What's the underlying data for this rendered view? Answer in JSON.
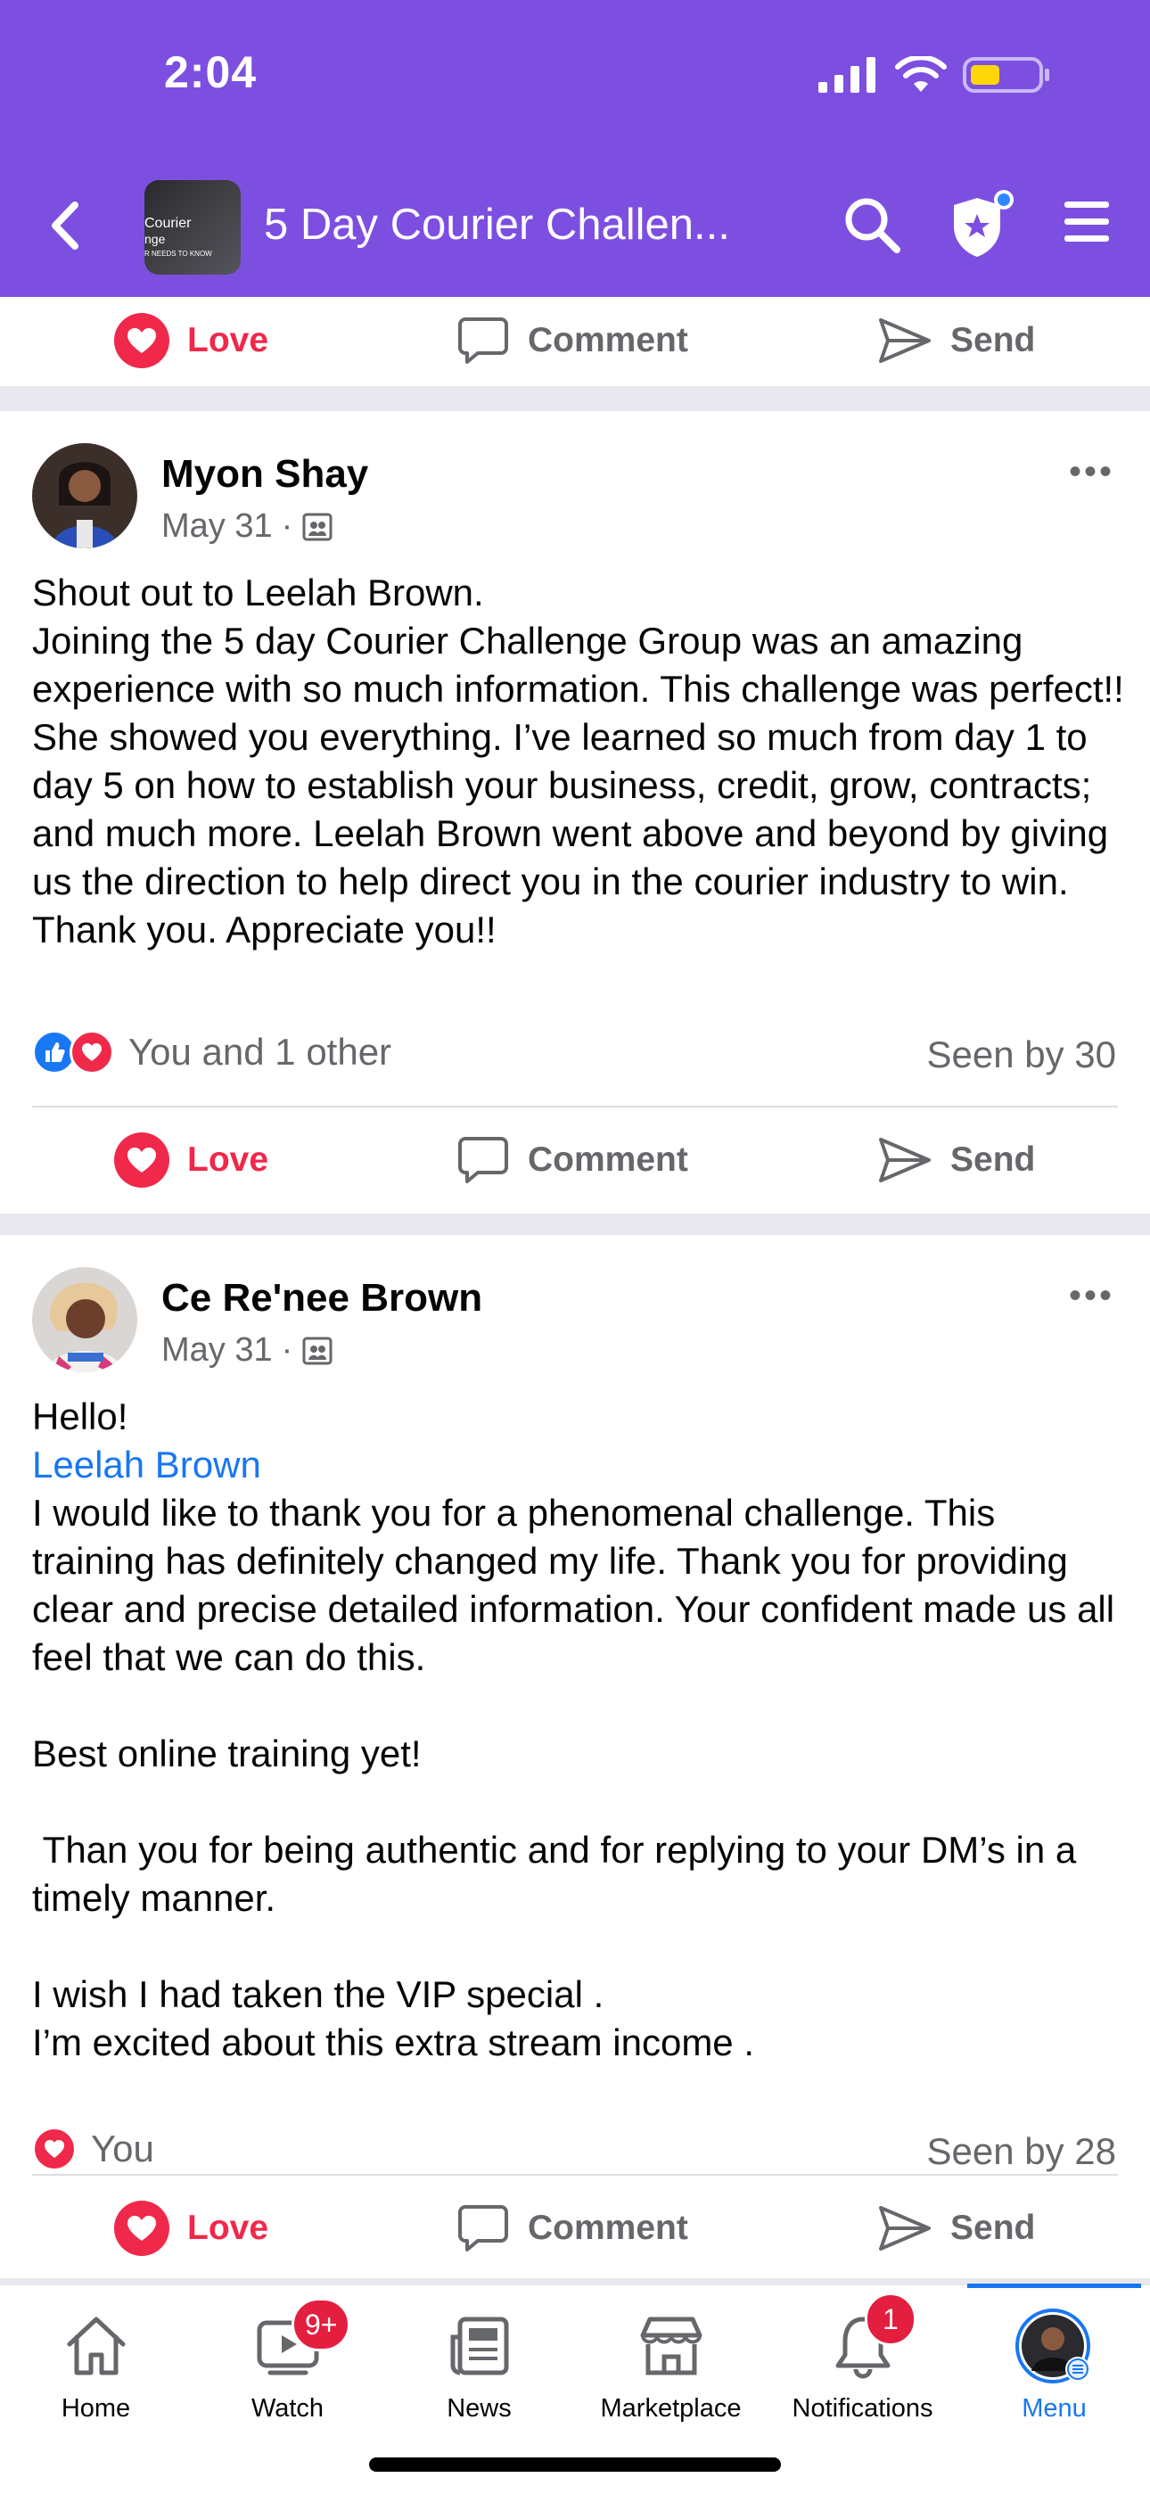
{
  "status_bar": {
    "time": "2:04"
  },
  "header": {
    "group_title": "5 Day Courier Challen...",
    "thumb_text_1": "Courier",
    "thumb_text_2": "nge",
    "thumb_text_3": "R NEEDS TO KNOW"
  },
  "top_actions": {
    "love": "Love",
    "comment": "Comment",
    "send": "Send"
  },
  "posts": [
    {
      "author": "Myon Shay",
      "date": "May 31",
      "dot": "·",
      "more": "•••",
      "lines": [
        "Shout out to Leelah Brown.",
        "Joining the 5 day Courier Challenge Group was an amazing experience with so much information. This challenge was perfect!! She showed you everything. I’ve learned so much from day 1 to day 5 on how to establish your business, credit, grow, contracts; and much more. Leelah Brown went above and beyond by giving us the direction to help direct you in the courier industry to win.",
        "Thank you. Appreciate you!!"
      ],
      "reactions_text": "You and 1 other",
      "seen": "Seen by 30",
      "actions": {
        "love": "Love",
        "comment": "Comment",
        "send": "Send"
      }
    },
    {
      "author": "Ce Re'nee Brown",
      "date": "May 31",
      "dot": "·",
      "more": "•••",
      "greeting": "Hello!",
      "mention": "Leelah Brown",
      "para1": "I would like to thank you for a phenomenal challenge. This training has definitely changed my life. Thank you for providing clear and precise detailed information.   Your confident made us all feel that we can do this.",
      "para2": "Best online training yet!",
      "para3": " Than you for being authentic and for replying to your DM’s in a timely manner.",
      "para4a": "I wish I had taken the VIP special .",
      "para4b": "I’m excited about this extra stream income .",
      "reactions_text": "You",
      "seen": "Seen by 28",
      "actions": {
        "love": "Love",
        "comment": "Comment",
        "send": "Send"
      }
    }
  ],
  "tabbar": {
    "items": [
      {
        "label": "Home",
        "icon": "home-icon"
      },
      {
        "label": "Watch",
        "icon": "watch-icon",
        "badge": "9+"
      },
      {
        "label": "News",
        "icon": "news-icon"
      },
      {
        "label": "Marketplace",
        "icon": "marketplace-icon"
      },
      {
        "label": "Notifications",
        "icon": "bell-icon",
        "badge": "1"
      },
      {
        "label": "Menu",
        "icon": "profile-avatar",
        "active": true
      }
    ]
  },
  "colors": {
    "header": "#7c4fe0",
    "love": "#f0284a",
    "link": "#1877f2",
    "active_tab": "#1877f2"
  }
}
